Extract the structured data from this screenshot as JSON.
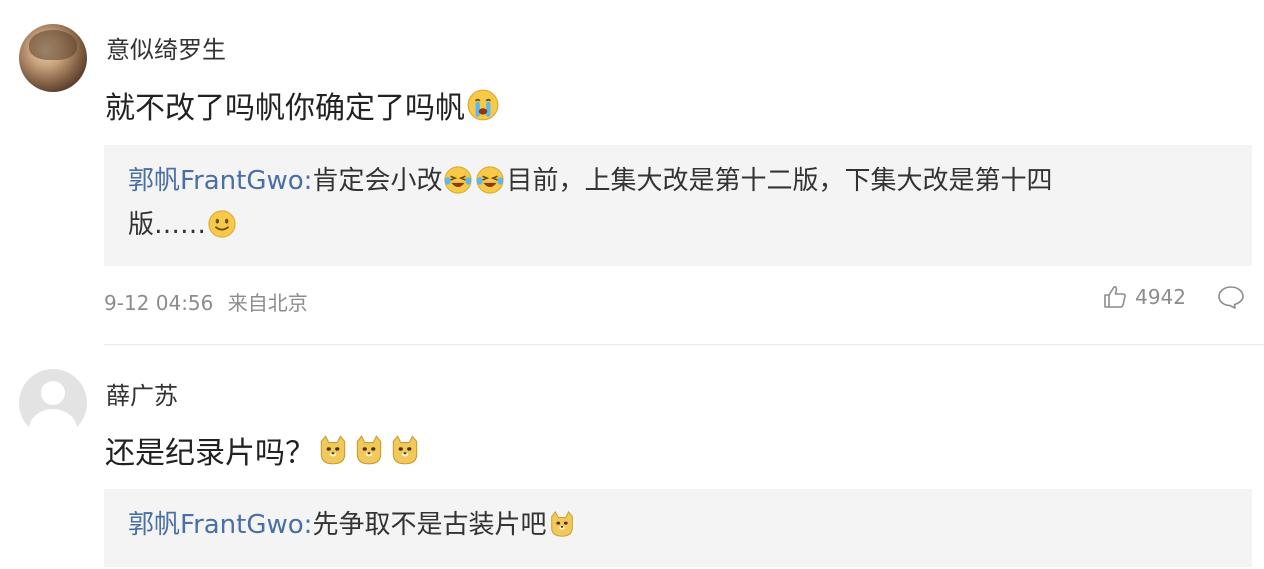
{
  "comments": [
    {
      "username": "意似绮罗生",
      "content": "就不改了吗帆你确定了吗帆",
      "content_emoji": [
        "crying-face"
      ],
      "reply": {
        "author": "郭帆FrantGwo:",
        "text_part1": "肯定会小改",
        "text_part2": "目前，上集大改是第十二版，下集大改是第十四",
        "text_part3": "版……",
        "emoji_after_part1": [
          "laughing-tears-face",
          "laughing-tears-face"
        ],
        "emoji_after_part3": [
          "smiling-face"
        ]
      },
      "meta": {
        "time": "9-12 04:56",
        "source": "来自北京"
      },
      "likes": "4942"
    },
    {
      "username": "薛广苏",
      "content": "还是纪录片吗？",
      "content_emoji": [
        "doge-face",
        "doge-face",
        "doge-face"
      ],
      "reply": {
        "author": "郭帆FrantGwo:",
        "text_part1": "先争取不是古装片吧",
        "emoji_after_part1": [
          "doge-face"
        ]
      }
    }
  ],
  "colors": {
    "reply_author": "#4a6fa5",
    "reply_bg": "#f4f4f4",
    "meta_text": "#8c8c8c"
  },
  "icons": [
    "thumbs-up-icon",
    "comment-bubble-icon"
  ]
}
